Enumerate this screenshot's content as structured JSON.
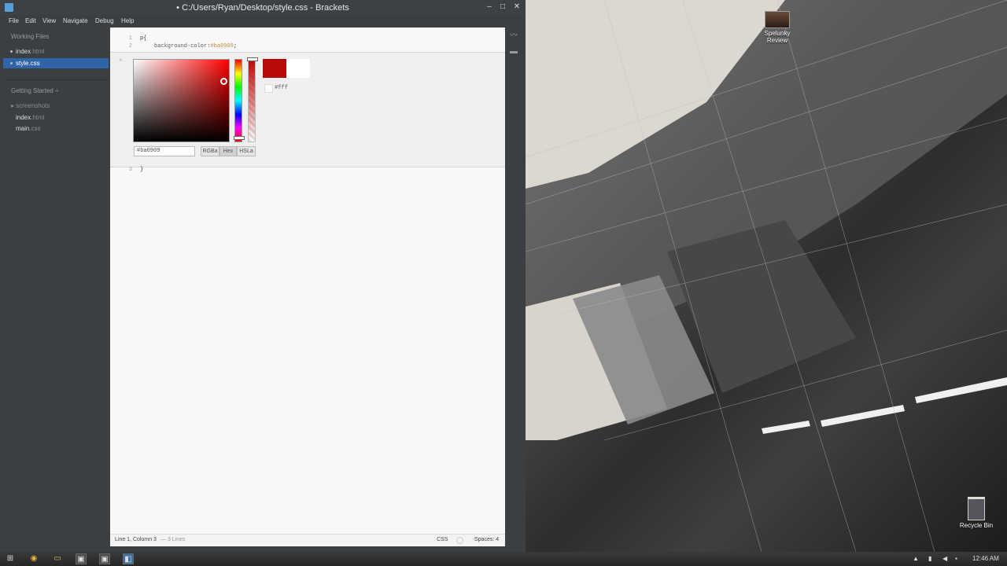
{
  "window": {
    "title": "• C:/Users/Ryan/Desktop/style.css - Brackets",
    "minimize": "–",
    "maximize": "□",
    "close": "✕"
  },
  "menu": [
    "File",
    "Edit",
    "View",
    "Navigate",
    "Debug",
    "Help"
  ],
  "sidebar": {
    "working_files_label": "Working Files",
    "working_files": [
      {
        "name": "index",
        "ext": ".html"
      },
      {
        "name": "style",
        "ext": ".css"
      }
    ],
    "project_label": "Getting Started ÷",
    "project_files": [
      {
        "name": "screenshots",
        "ext": ""
      },
      {
        "name": "index",
        "ext": ".html"
      },
      {
        "name": "main",
        "ext": ".css"
      }
    ]
  },
  "editor": {
    "lines": [
      "1",
      "2",
      "3"
    ],
    "line1": "p{",
    "line2_prop": "background-color:",
    "line2_val": "#ba0909",
    "line2_end": ";",
    "line3": "}"
  },
  "color_picker": {
    "current_color": "#ba0909",
    "original_color": "#fff",
    "hex_value": "#ba0909",
    "formats": [
      "RGBa",
      "Hex",
      "HSLa"
    ],
    "selected_format": "Hex",
    "close": "×"
  },
  "statusbar": {
    "cursor": "Line 1, Column 3",
    "lines": "— 3 Lines",
    "mode": "CSS",
    "spaces": "Spaces: 4"
  },
  "desktop": {
    "icon_label": "Spelunky Review",
    "recycle_label": "Recycle Bin"
  },
  "taskbar": {
    "clock": "12:46 AM"
  }
}
